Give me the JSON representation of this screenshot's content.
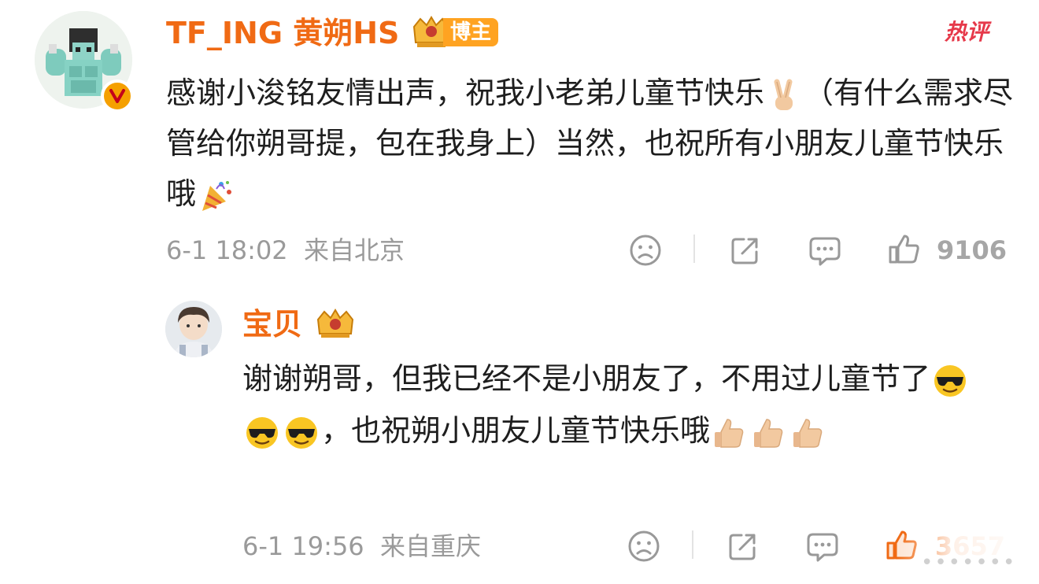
{
  "comment": {
    "username": "TF_ING 黄朔HS",
    "badge": "博主",
    "hot_tag": "热评",
    "text_part1": "感谢小浚铭友情出声，祝我小老弟儿童节快乐",
    "text_part2": "（有什么需求尽管给你朔哥提，包在我身上）当然，也祝所有小朋友儿童节快乐哦",
    "time": "6-1 18:02",
    "location": "来自北京",
    "like_count": "9106",
    "icons": [
      "sad-face-icon",
      "share-icon",
      "comment-icon",
      "thumbs-up-icon"
    ]
  },
  "reply": {
    "username": "宝贝",
    "text_part1": "谢谢朔哥，但我已经不是小朋友了，不用过儿童节了",
    "text_part2": "，也祝朔小朋友儿童节快乐哦",
    "time": "6-1 19:56",
    "location": "来自重庆",
    "like_count": "3657"
  },
  "watermark": "•••••••",
  "colors": {
    "username": "#f06a14",
    "badge_bg": "#ffa321",
    "hot_tag": "#e6394a",
    "meta": "#9a9a9a",
    "liked": "#f06a14"
  }
}
